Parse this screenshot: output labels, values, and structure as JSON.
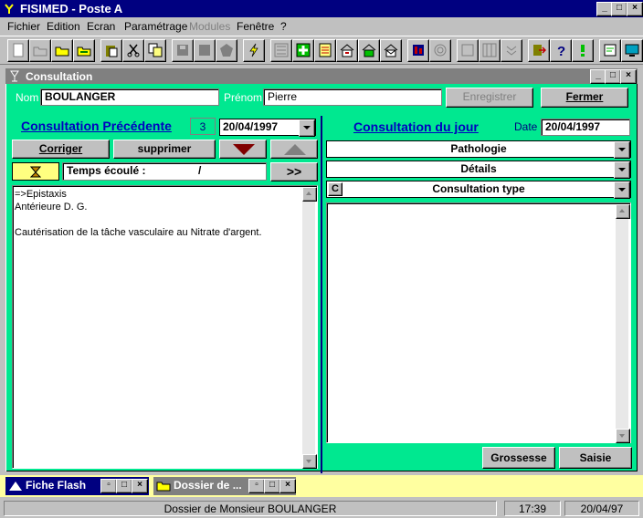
{
  "app": {
    "title": "FISIMED - Poste A"
  },
  "menu": [
    "Fichier",
    "Edition",
    "Ecran",
    "Paramétrage",
    "Modules",
    "Fenêtre",
    "?"
  ],
  "consultation_window": {
    "title": "Consultation"
  },
  "patient": {
    "nom_label": "Nom",
    "nom": "BOULANGER",
    "prenom_label": "Prénom",
    "prenom": "Pierre",
    "enregistrer": "Enregistrer",
    "fermer": "Fermer"
  },
  "previous": {
    "title": "Consultation Précédente",
    "count": "3",
    "date": "20/04/1997",
    "corriger": "Corriger",
    "supprimer": "supprimer",
    "temps_label": "Temps écoulé :",
    "temps_value": "/",
    "forward": ">>",
    "notes": [
      "=>Epistaxis",
      "Antérieure D. G.",
      "",
      "Cautérisation de la tâche vasculaire au Nitrate d'argent."
    ]
  },
  "today": {
    "title": "Consultation du jour",
    "date_label": "Date",
    "date": "20/04/1997",
    "pathologie": "Pathologie",
    "details": "Détails",
    "consult_type_code": "C",
    "consult_type": "Consultation type",
    "grossesse": "Grossesse",
    "saisie": "Saisie"
  },
  "taskbar": [
    {
      "label": "Fiche Flash"
    },
    {
      "label": "Dossier de ..."
    }
  ],
  "status": {
    "message": "Dossier de Monsieur BOULANGER",
    "time": "17:39",
    "date": "20/04/97"
  },
  "colors": {
    "titlebar": "#000080",
    "panel": "#00e890",
    "link": "#0000c0",
    "taskbar": "#ffffa0"
  }
}
